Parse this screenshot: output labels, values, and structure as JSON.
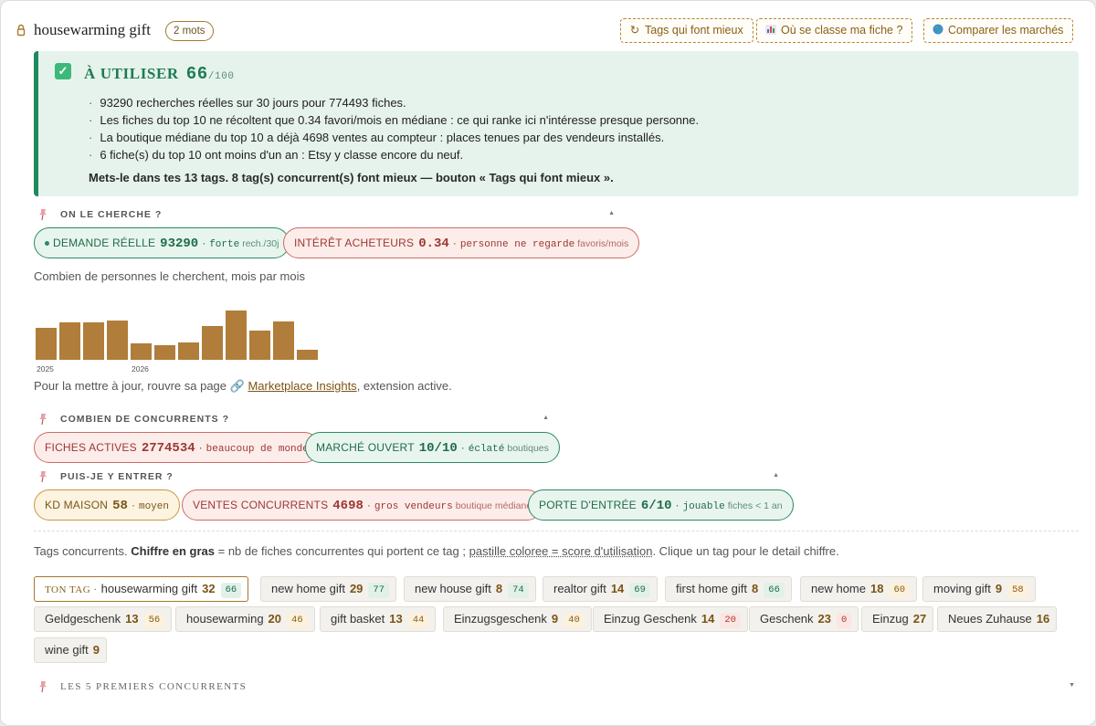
{
  "header": {
    "keyword": "housewarming gift",
    "word_count": "2 mots",
    "buttons": [
      {
        "icon": "refresh-icon",
        "label": "Tags qui font mieux"
      },
      {
        "icon": "chart-icon",
        "label": "Où se classe ma fiche ?"
      },
      {
        "icon": "globe-icon",
        "label": "Comparer les marchés"
      }
    ]
  },
  "verdict": {
    "title": "À UTILISER",
    "score": "66",
    "max": "/100",
    "bullets": [
      "93290 recherches réelles sur 30 jours pour 774493 fiches.",
      "Les fiches du top 10 ne récoltent que 0.34 favori/mois en médiane : ce qui ranke ici n'intéresse presque personne.",
      "La boutique médiane du top 10 a déjà 4698 ventes au compteur : places tenues par des vendeurs installés.",
      "6 fiche(s) du top 10 ont moins d'un an : Etsy y classe encore du neuf."
    ],
    "footer": "Mets-le dans tes 13 tags. 8 tag(s) concurrent(s) font mieux — bouton « Tags qui font mieux »."
  },
  "demand": {
    "section_label": "ON LE CHERCHE ?",
    "pills": [
      {
        "label": "DEMANDE RÉELLE",
        "value": "93290",
        "qualifier": "forte",
        "unit": "rech./30j"
      },
      {
        "label": "INTÉRÊT ACHETEURS",
        "value": "0.34",
        "qualifier": "personne ne regarde",
        "unit": "favoris/mois"
      }
    ],
    "chart_caption": "Combien de personnes le cherchent, mois par mois",
    "chart_data": {
      "type": "bar",
      "values": [
        34,
        39,
        39,
        41,
        17,
        15,
        18,
        36,
        52,
        31,
        40,
        11
      ],
      "tick_labels": [
        "2025",
        "2026"
      ]
    },
    "update_prefix": "Pour la mettre à jour, rouvre sa page",
    "update_link": "Marketplace Insights",
    "update_suffix": ", extension active."
  },
  "competition": {
    "section_label": "COMBIEN DE CONCURRENTS ?",
    "pills": [
      {
        "label": "FICHES ACTIVES",
        "value": "2774534",
        "qualifier": "beaucoup de monde"
      },
      {
        "label": "MARCHÉ OUVERT",
        "value": "10/10",
        "qualifier": "éclaté",
        "unit": "boutiques"
      }
    ]
  },
  "entry": {
    "section_label": "PUIS-JE Y ENTRER ?",
    "pills": [
      {
        "label": "KD MAISON",
        "value": "58",
        "qualifier": "moyen"
      },
      {
        "label": "VENTES CONCURRENTS",
        "value": "4698",
        "qualifier": "gros vendeurs",
        "unit": "boutique médiane"
      },
      {
        "label": "PORTE D'ENTRÉE",
        "value": "6/10",
        "qualifier": "jouable",
        "unit": "fiches < 1 an"
      }
    ]
  },
  "tags_intro": {
    "prefix": "Tags concurrents.",
    "bold": "Chiffre en gras",
    "middle": "= nb de fiches concurrentes qui portent ce tag ;",
    "underlined": "pastille coloree = score d'utilisation",
    "suffix": ". Clique un tag pour le detail chiffre."
  },
  "tags": {
    "mine_label": "TON TAG ·",
    "items": [
      {
        "name": "housewarming gift",
        "count": "32",
        "score": "66",
        "tone": "g"
      },
      {
        "name": "new home gift",
        "count": "29",
        "score": "77",
        "tone": "g"
      },
      {
        "name": "new house gift",
        "count": "8",
        "score": "74",
        "tone": "g"
      },
      {
        "name": "realtor gift",
        "count": "14",
        "score": "69",
        "tone": "g"
      },
      {
        "name": "first home gift",
        "count": "8",
        "score": "66",
        "tone": "g"
      },
      {
        "name": "new home",
        "count": "18",
        "score": "60",
        "tone": "a"
      },
      {
        "name": "moving gift",
        "count": "9",
        "score": "58",
        "tone": "a"
      },
      {
        "name": "Geldgeschenk",
        "count": "13",
        "score": "56",
        "tone": "a"
      },
      {
        "name": "housewarming",
        "count": "20",
        "score": "46",
        "tone": "a"
      },
      {
        "name": "gift basket",
        "count": "13",
        "score": "44",
        "tone": "a"
      },
      {
        "name": "Einzugsgeschenk",
        "count": "9",
        "score": "40",
        "tone": "a"
      },
      {
        "name": "Einzug Geschenk",
        "count": "14",
        "score": "20",
        "tone": "r"
      },
      {
        "name": "Geschenk",
        "count": "23",
        "score": "0",
        "tone": "r"
      },
      {
        "name": "Einzug",
        "count": "27",
        "score": "",
        "tone": ""
      },
      {
        "name": "Neues Zuhause",
        "count": "16",
        "score": "",
        "tone": ""
      },
      {
        "name": "wine gift",
        "count": "9",
        "score": "",
        "tone": ""
      }
    ]
  },
  "top5": {
    "section_label": "LES 5 PREMIERS CONCURRENTS"
  },
  "colors": {
    "accent": "#b07d3a",
    "good": "#1e8a5e",
    "bad": "#cc6d65"
  }
}
